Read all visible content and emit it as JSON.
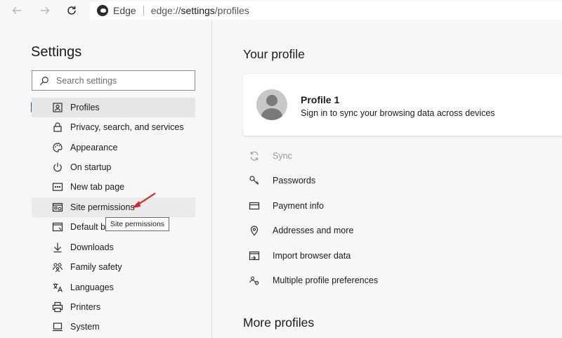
{
  "browser": {
    "name": "Edge",
    "url_prefix": "edge://",
    "url_path": "settings",
    "url_suffix": "/profiles"
  },
  "sidebar": {
    "title": "Settings",
    "search_placeholder": "Search settings",
    "items": [
      {
        "label": "Profiles",
        "icon": "profile-icon",
        "active": true
      },
      {
        "label": "Privacy, search, and services",
        "icon": "lock-icon"
      },
      {
        "label": "Appearance",
        "icon": "palette-icon"
      },
      {
        "label": "On startup",
        "icon": "power-icon"
      },
      {
        "label": "New tab page",
        "icon": "new-tab-icon"
      },
      {
        "label": "Site permissions",
        "icon": "site-permissions-icon",
        "hover": true
      },
      {
        "label": "Default b",
        "icon": "default-browser-icon"
      },
      {
        "label": "Downloads",
        "icon": "download-icon"
      },
      {
        "label": "Family safety",
        "icon": "family-icon"
      },
      {
        "label": "Languages",
        "icon": "languages-icon"
      },
      {
        "label": "Printers",
        "icon": "printer-icon"
      },
      {
        "label": "System",
        "icon": "system-icon"
      }
    ],
    "tooltip": "Site permissions"
  },
  "main": {
    "title": "Your profile",
    "profile": {
      "name": "Profile 1",
      "subtitle": "Sign in to sync your browsing data across devices"
    },
    "options": [
      {
        "label": "Sync",
        "icon": "sync-icon",
        "disabled": true
      },
      {
        "label": "Passwords",
        "icon": "key-icon"
      },
      {
        "label": "Payment info",
        "icon": "card-icon"
      },
      {
        "label": "Addresses and more",
        "icon": "location-icon"
      },
      {
        "label": "Import browser data",
        "icon": "import-icon"
      },
      {
        "label": "Multiple profile preferences",
        "icon": "multi-profile-icon"
      }
    ],
    "more_title": "More profiles"
  },
  "colors": {
    "accent": "#0f6cbd",
    "arrow": "#e02020"
  }
}
